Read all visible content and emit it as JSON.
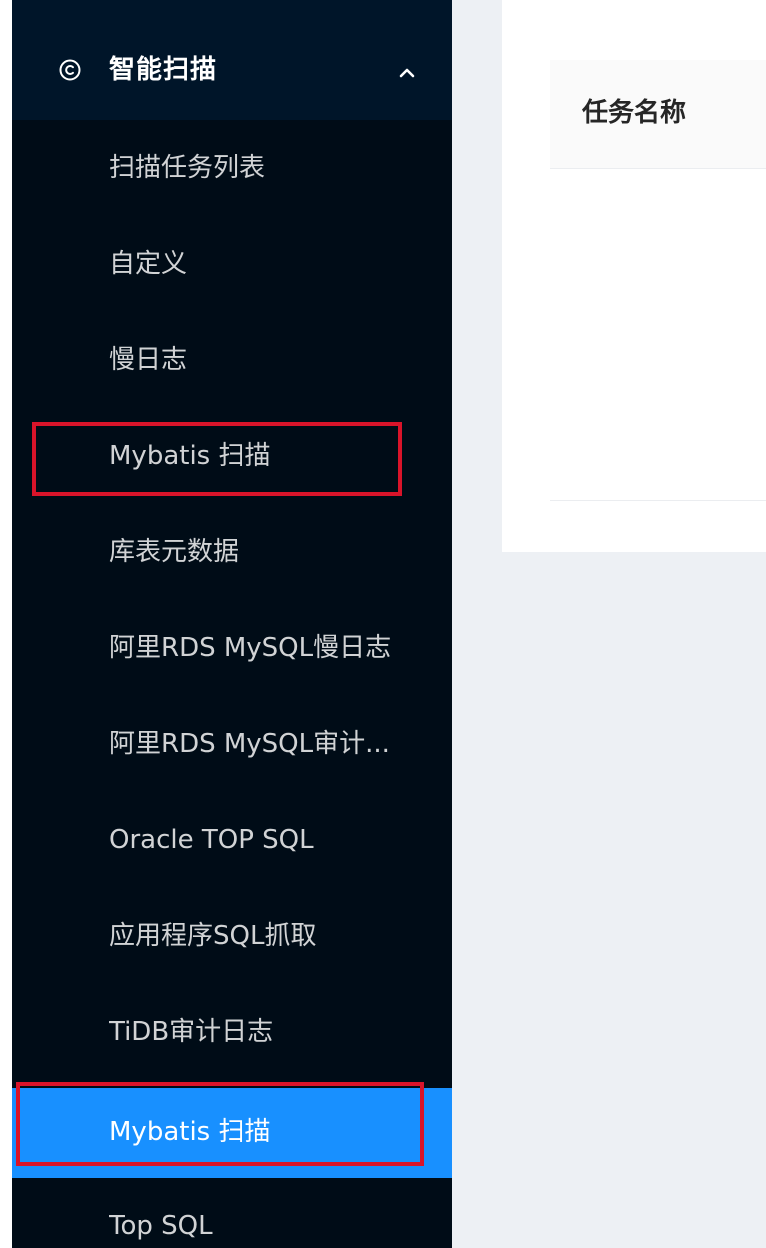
{
  "sidebar": {
    "submenu": {
      "icon": "copyright-circle-icon",
      "title": "智能扫描",
      "chevron": "chevron-up-icon",
      "expanded": true
    },
    "items": [
      {
        "label": "扫描任务列表"
      },
      {
        "label": "自定义"
      },
      {
        "label": "慢日志"
      },
      {
        "label": "Mybatis 扫描"
      },
      {
        "label": "库表元数据"
      },
      {
        "label": "阿里RDS MySQL慢日志"
      },
      {
        "label": "阿里RDS MySQL审计..."
      },
      {
        "label": "Oracle TOP SQL"
      },
      {
        "label": "应用程序SQL抓取"
      },
      {
        "label": "TiDB审计日志"
      },
      {
        "label": "Mybatis 扫描",
        "selected": true
      },
      {
        "label": "Top SQL"
      }
    ]
  },
  "main": {
    "table": {
      "columns": [
        "任务名称"
      ]
    }
  },
  "colors": {
    "sidebar_bg": "#001529",
    "submenu_bg": "#000c17",
    "selected_bg": "#1890ff",
    "highlight_border": "#d9142a",
    "content_bg": "#edf0f4"
  }
}
